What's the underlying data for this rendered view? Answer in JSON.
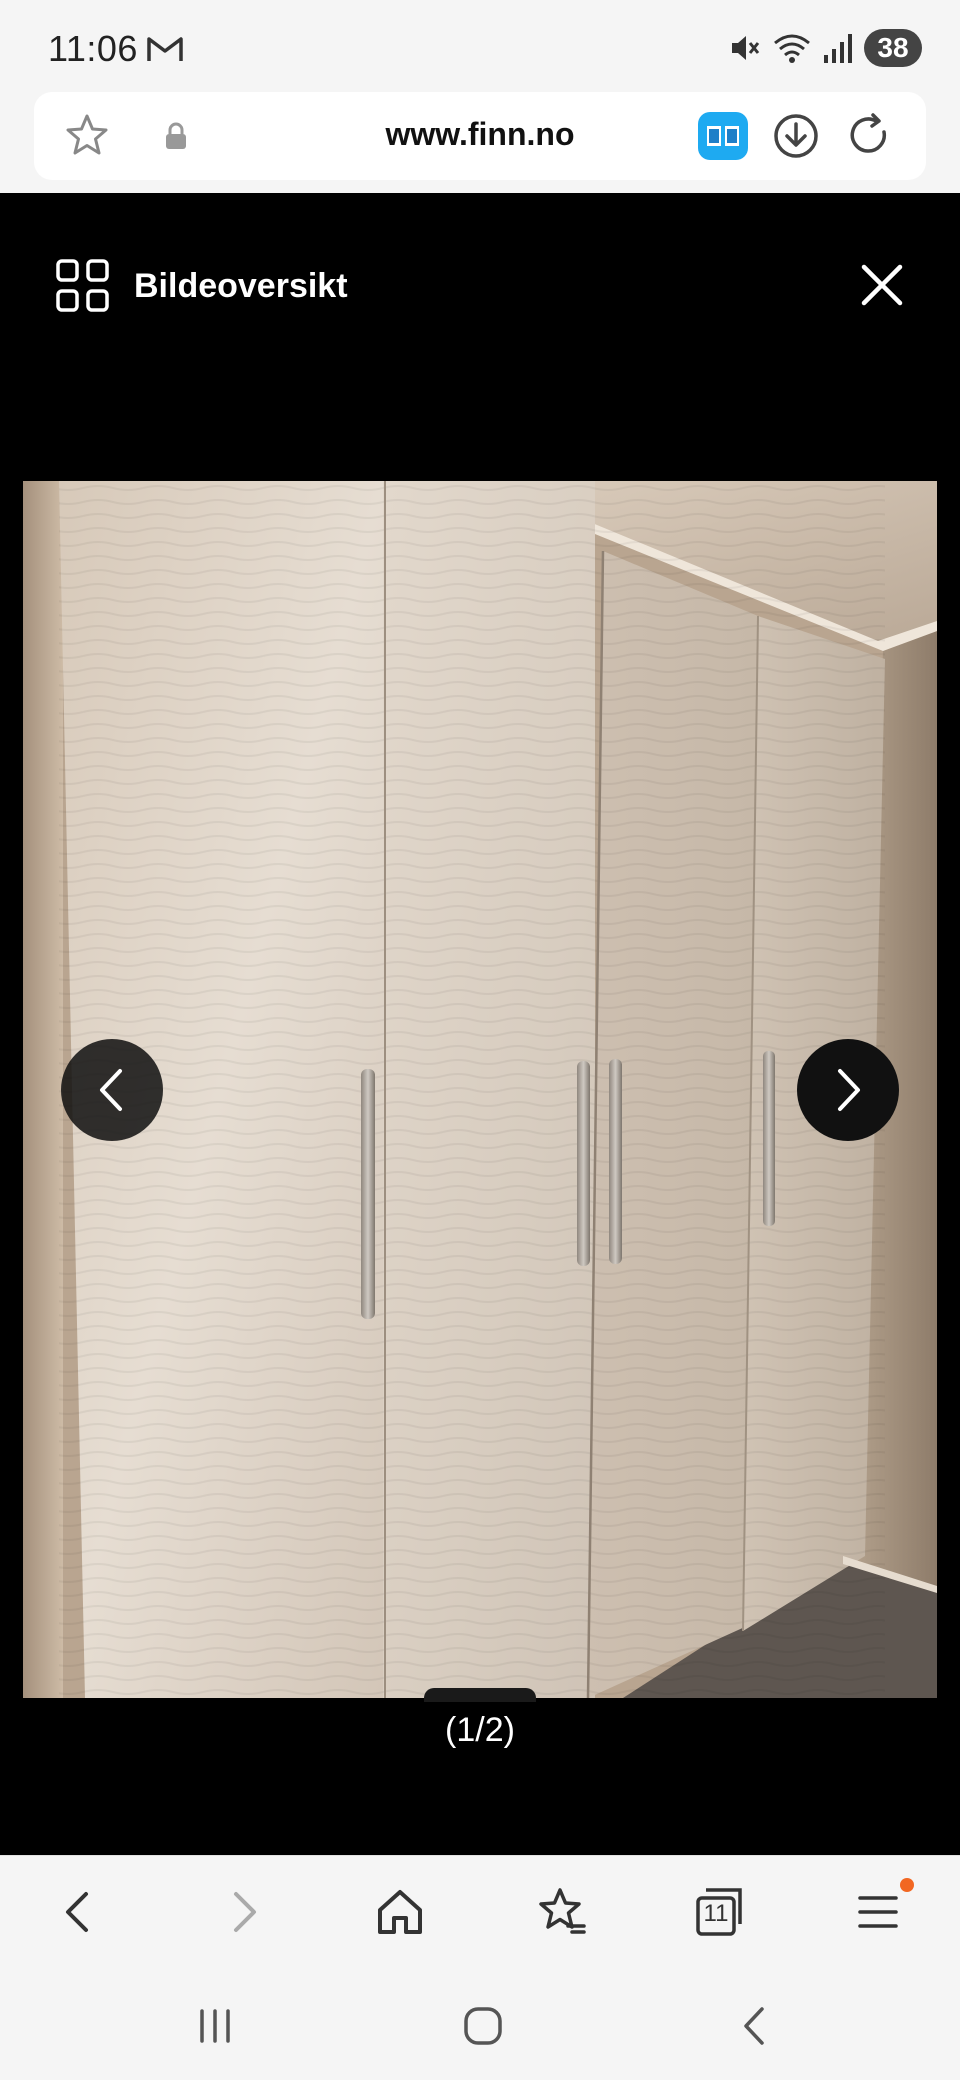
{
  "status_bar": {
    "time": "11:06",
    "battery": "38",
    "icons": [
      "gmail-icon",
      "mute-icon",
      "wifi-icon",
      "signal-icon"
    ]
  },
  "browser": {
    "url": "www.finn.no",
    "icons": [
      "star-outline-icon",
      "lock-icon",
      "reader-mode-icon",
      "download-icon",
      "reload-icon"
    ],
    "accent_color": "#1eaaf1"
  },
  "gallery": {
    "title": "Bildeoversikt",
    "counter": "(1/2)",
    "image_alt": "White wardrobe doors with metal handles",
    "icons": [
      "grid-icon",
      "close-icon",
      "chevron-left-icon",
      "chevron-right-icon"
    ]
  },
  "toolbar": {
    "tabs_count": "11",
    "notification_color": "#f26722",
    "icons": [
      "back-icon",
      "forward-icon",
      "home-icon",
      "bookmarks-icon",
      "tabs-icon",
      "menu-icon"
    ]
  },
  "system_nav": {
    "icons": [
      "recent-apps-icon",
      "home-circle-icon",
      "system-back-icon"
    ]
  }
}
